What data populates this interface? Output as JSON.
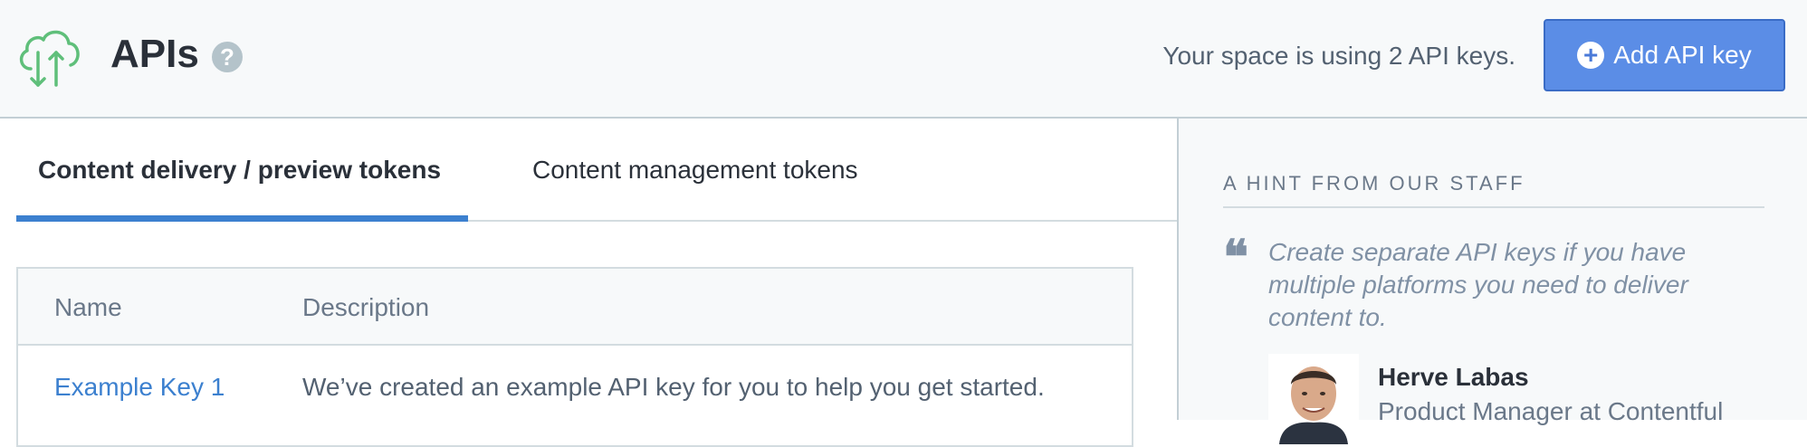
{
  "header": {
    "logo_icon": "cloud-upload-download-icon",
    "title": "APIs",
    "help_icon": "question-mark-icon",
    "help_glyph": "?",
    "usage_text": "Your space is using 2 API keys.",
    "add_button_label": "Add API key",
    "add_button_icon": "plus-circle-icon",
    "add_button_glyph": "+"
  },
  "tabs": [
    {
      "label": "Content delivery / preview tokens",
      "active": true
    },
    {
      "label": "Content management tokens",
      "active": false
    }
  ],
  "table": {
    "columns": [
      "Name",
      "Description"
    ],
    "rows": [
      {
        "name": "Example Key 1",
        "description": "We’ve created an example API key for you to help you get started."
      }
    ]
  },
  "sidebar": {
    "heading": "A HINT FROM OUR STAFF",
    "quote_icon": "quote-icon",
    "quote_glyph": "❝",
    "quote": "Create separate API keys if you have multiple platforms you need to deliver content to.",
    "author_name": "Herve Labas",
    "author_role": "Product Manager at Contentful"
  },
  "colors": {
    "accent": "#3c80cf",
    "button": "#5b8de6",
    "logo": "#5fbf7a"
  }
}
